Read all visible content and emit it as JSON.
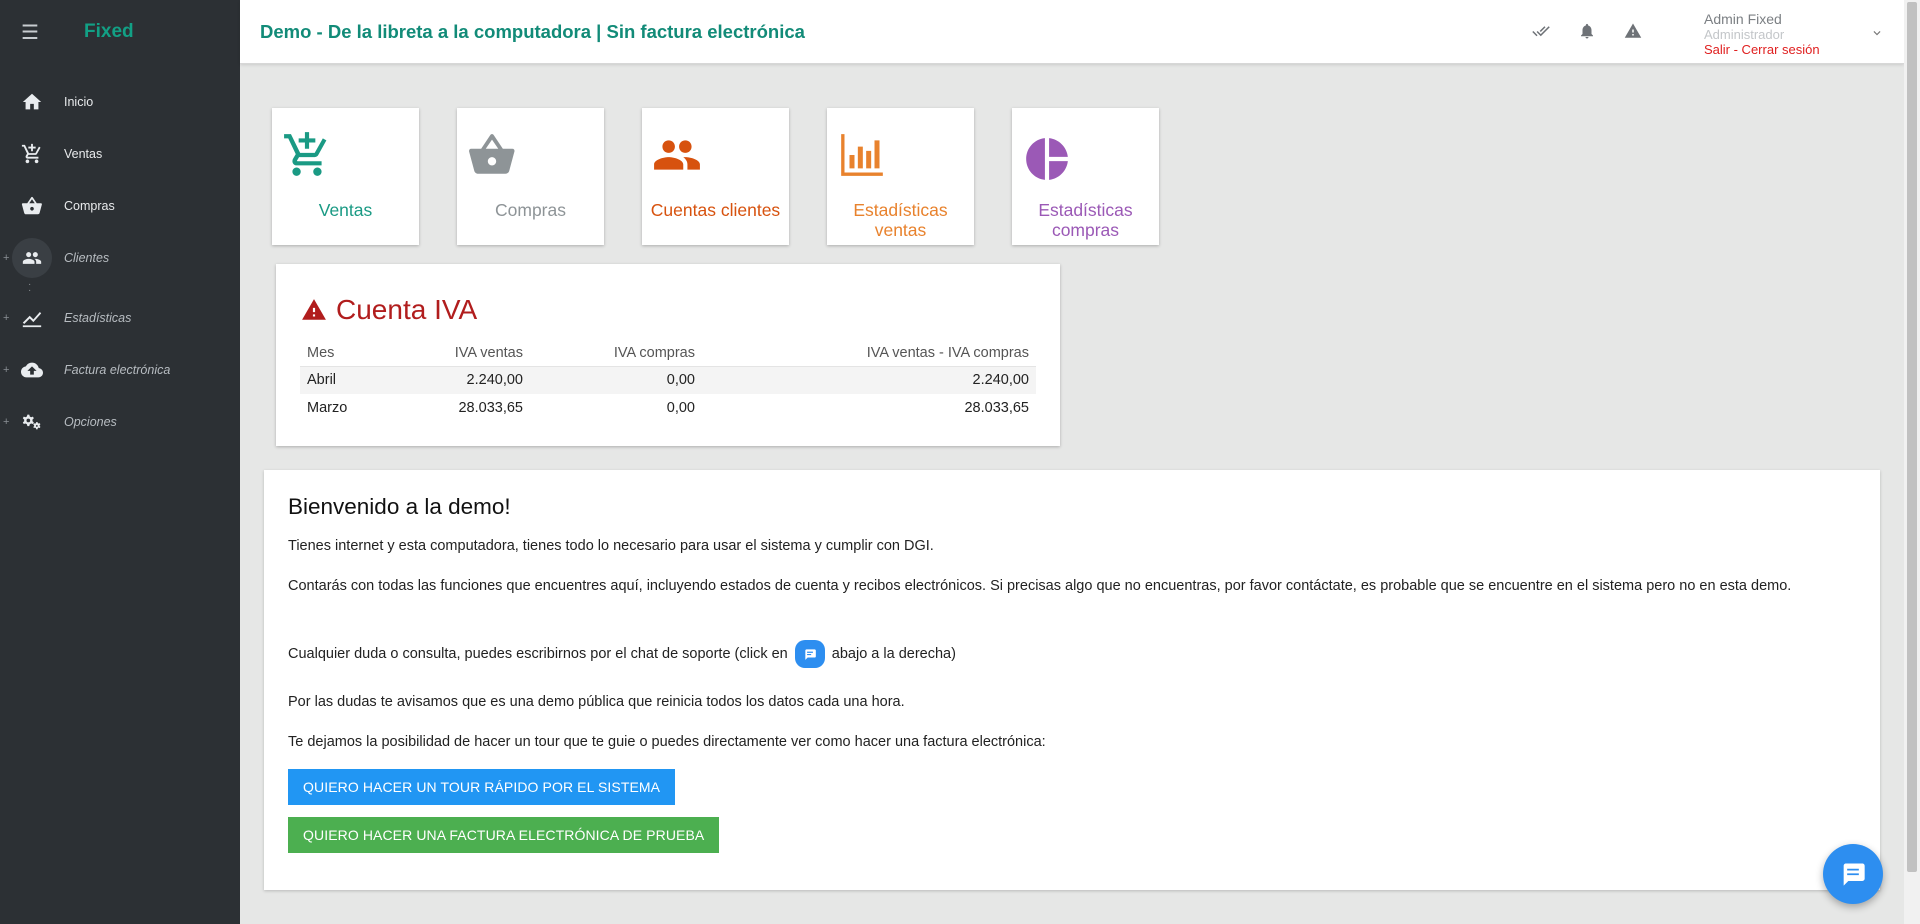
{
  "sidebar": {
    "brand": "Fixed",
    "hamburger_icon": "☰",
    "items": [
      {
        "label": "Inicio",
        "icon": "home-icon"
      },
      {
        "label": "Ventas",
        "icon": "cart-plus-icon"
      },
      {
        "label": "Compras",
        "icon": "basket-icon"
      },
      {
        "label": "Clientes",
        "icon": "people-icon"
      },
      {
        "label": "Estadísticas",
        "icon": "chart-line-icon"
      },
      {
        "label": "Factura electrónica",
        "icon": "cloud-upload-icon"
      },
      {
        "label": "Opciones",
        "icon": "gears-icon"
      }
    ],
    "plus_glyph": "+"
  },
  "header": {
    "title": "Demo - De la libreta a la computadora | Sin factura electrónica",
    "icons": [
      "done-all-icon",
      "bell-icon",
      "warning-icon"
    ],
    "user": {
      "name": "Admin Fixed",
      "role": "Administrador",
      "logout": "Salir - Cerrar sesión"
    }
  },
  "tiles": [
    {
      "label": "Ventas",
      "color": "#1a9a84",
      "icon": "cart-plus-icon"
    },
    {
      "label": "Compras",
      "color": "#8e9497",
      "icon": "basket-icon"
    },
    {
      "label": "Cuentas clientes",
      "color": "#d7520e",
      "icon": "people-icon"
    },
    {
      "label_line1": "Estadísticas",
      "label_line2": "ventas",
      "color": "#e8822d",
      "icon": "bar-chart-icon"
    },
    {
      "label_line1": "Estadísticas",
      "label_line2": "compras",
      "color": "#9b59b6",
      "icon": "pie-chart-icon"
    }
  ],
  "iva": {
    "title": "Cuenta IVA",
    "columns": [
      "Mes",
      "IVA ventas",
      "IVA compras",
      "IVA ventas - IVA compras"
    ],
    "rows": [
      [
        "Abril",
        "2.240,00",
        "0,00",
        "2.240,00"
      ],
      [
        "Marzo",
        "28.033,65",
        "0,00",
        "28.033,65"
      ]
    ]
  },
  "welcome": {
    "title": "Bienvenido a la demo!",
    "p1": "Tienes internet y esta computadora, tienes todo lo necesario para usar el sistema y cumplir con DGI.",
    "p2": "Contarás con todas las funciones que encuentres aquí, incluyendo estados de cuenta y recibos electrónicos. Si precisas algo que no encuentras, por favor contáctate, es probable que se encuentre en el sistema pero no en esta demo.",
    "p3_before": "Cualquier duda o consulta, puedes escribirnos por el chat de soporte (click en",
    "p3_after": "abajo a la derecha)",
    "p4": "Por las dudas te avisamos que es una demo pública que reinicia todos los datos cada una hora.",
    "p5": "Te dejamos la posibilidad de hacer un tour que te guie o puedes directamente ver como hacer una factura electrónica:",
    "btn_tour": "QUIERO HACER UN TOUR RÁPIDO POR EL SISTEMA",
    "btn_factura": "QUIERO HACER UNA FACTURA ELECTRÓNICA DE PRUEBA"
  },
  "colors": {
    "sidebar_bg": "#2c3034",
    "brand": "#12a085",
    "title": "#128b78",
    "logout": "#e02020",
    "iva_red": "#b11d1d",
    "btn_blue": "#2196f3",
    "btn_green": "#4caf50",
    "chat_blue": "#2d8ef0"
  }
}
